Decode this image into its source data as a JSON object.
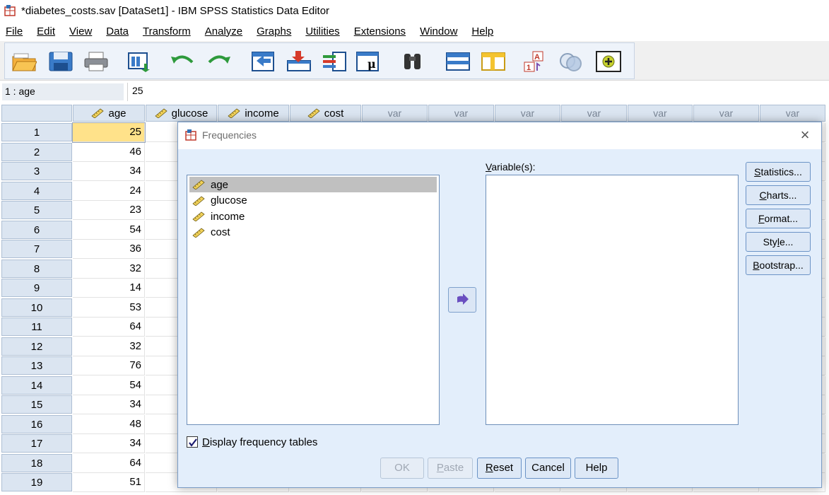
{
  "window": {
    "title": "*diabetes_costs.sav [DataSet1] - IBM SPSS Statistics Data Editor",
    "icon": "spss-app-icon"
  },
  "menu": [
    {
      "label": "File",
      "icon": ""
    },
    {
      "label": "Edit"
    },
    {
      "label": "View"
    },
    {
      "label": "Data"
    },
    {
      "label": "Transform"
    },
    {
      "label": "Analyze"
    },
    {
      "label": "Graphs"
    },
    {
      "label": "Utilities"
    },
    {
      "label": "Extensions"
    },
    {
      "label": "Window"
    },
    {
      "label": "Help"
    }
  ],
  "toolbar": [
    "open-data-icon",
    "save-icon",
    "print-icon",
    "recall-dialog-icon",
    "undo-icon",
    "redo-icon",
    "go-to-case-icon",
    "go-to-variable-icon",
    "variables-icon",
    "run-descriptive-icon",
    "find-icon",
    "insert-cases-icon",
    "insert-variable-icon",
    "split-file-icon",
    "weight-cases-icon",
    "select-cases-icon",
    "value-labels-icon",
    "use-sets-icon",
    "spelling-icon"
  ],
  "cell_editor": {
    "ref": "1 : age",
    "value": "25"
  },
  "grid": {
    "columns": [
      "age",
      "glucose",
      "income",
      "cost",
      "var",
      "var",
      "var",
      "var",
      "var",
      "var",
      "var"
    ],
    "rows": [
      {
        "num": "1",
        "age": "25"
      },
      {
        "num": "2",
        "age": "46"
      },
      {
        "num": "3",
        "age": "34"
      },
      {
        "num": "4",
        "age": "24"
      },
      {
        "num": "5",
        "age": "23"
      },
      {
        "num": "6",
        "age": "54"
      },
      {
        "num": "7",
        "age": "36"
      },
      {
        "num": "8",
        "age": "32"
      },
      {
        "num": "9",
        "age": "14"
      },
      {
        "num": "10",
        "age": "53"
      },
      {
        "num": "11",
        "age": "64"
      },
      {
        "num": "12",
        "age": "32"
      },
      {
        "num": "13",
        "age": "76"
      },
      {
        "num": "14",
        "age": "54"
      },
      {
        "num": "15",
        "age": "34"
      },
      {
        "num": "16",
        "age": "48"
      },
      {
        "num": "17",
        "age": "34"
      },
      {
        "num": "18",
        "age": "64"
      },
      {
        "num": "19",
        "age": "51"
      }
    ],
    "selected_row": "1",
    "selected_color": "#ffe28a"
  },
  "dialog": {
    "title": "Frequencies",
    "close": "×",
    "source_items": [
      "age",
      "glucose",
      "income",
      "cost"
    ],
    "selected_source": "age",
    "variables_label": "Variable(s):",
    "target_items": [],
    "side_buttons": [
      "Statistics...",
      "Charts...",
      "Format...",
      "Style...",
      "Bootstrap..."
    ],
    "checkbox": {
      "label": "Display frequency tables",
      "checked": true
    },
    "bottom_buttons": [
      {
        "label": "OK",
        "enabled": false
      },
      {
        "label": "Paste",
        "enabled": false
      },
      {
        "label": "Reset",
        "enabled": true
      },
      {
        "label": "Cancel",
        "enabled": true
      },
      {
        "label": "Help",
        "enabled": true
      }
    ]
  },
  "colors": {
    "header_bg": "#dbe5f1",
    "dialog_bg": "#e3eefb",
    "button_border": "#6b93c6"
  }
}
